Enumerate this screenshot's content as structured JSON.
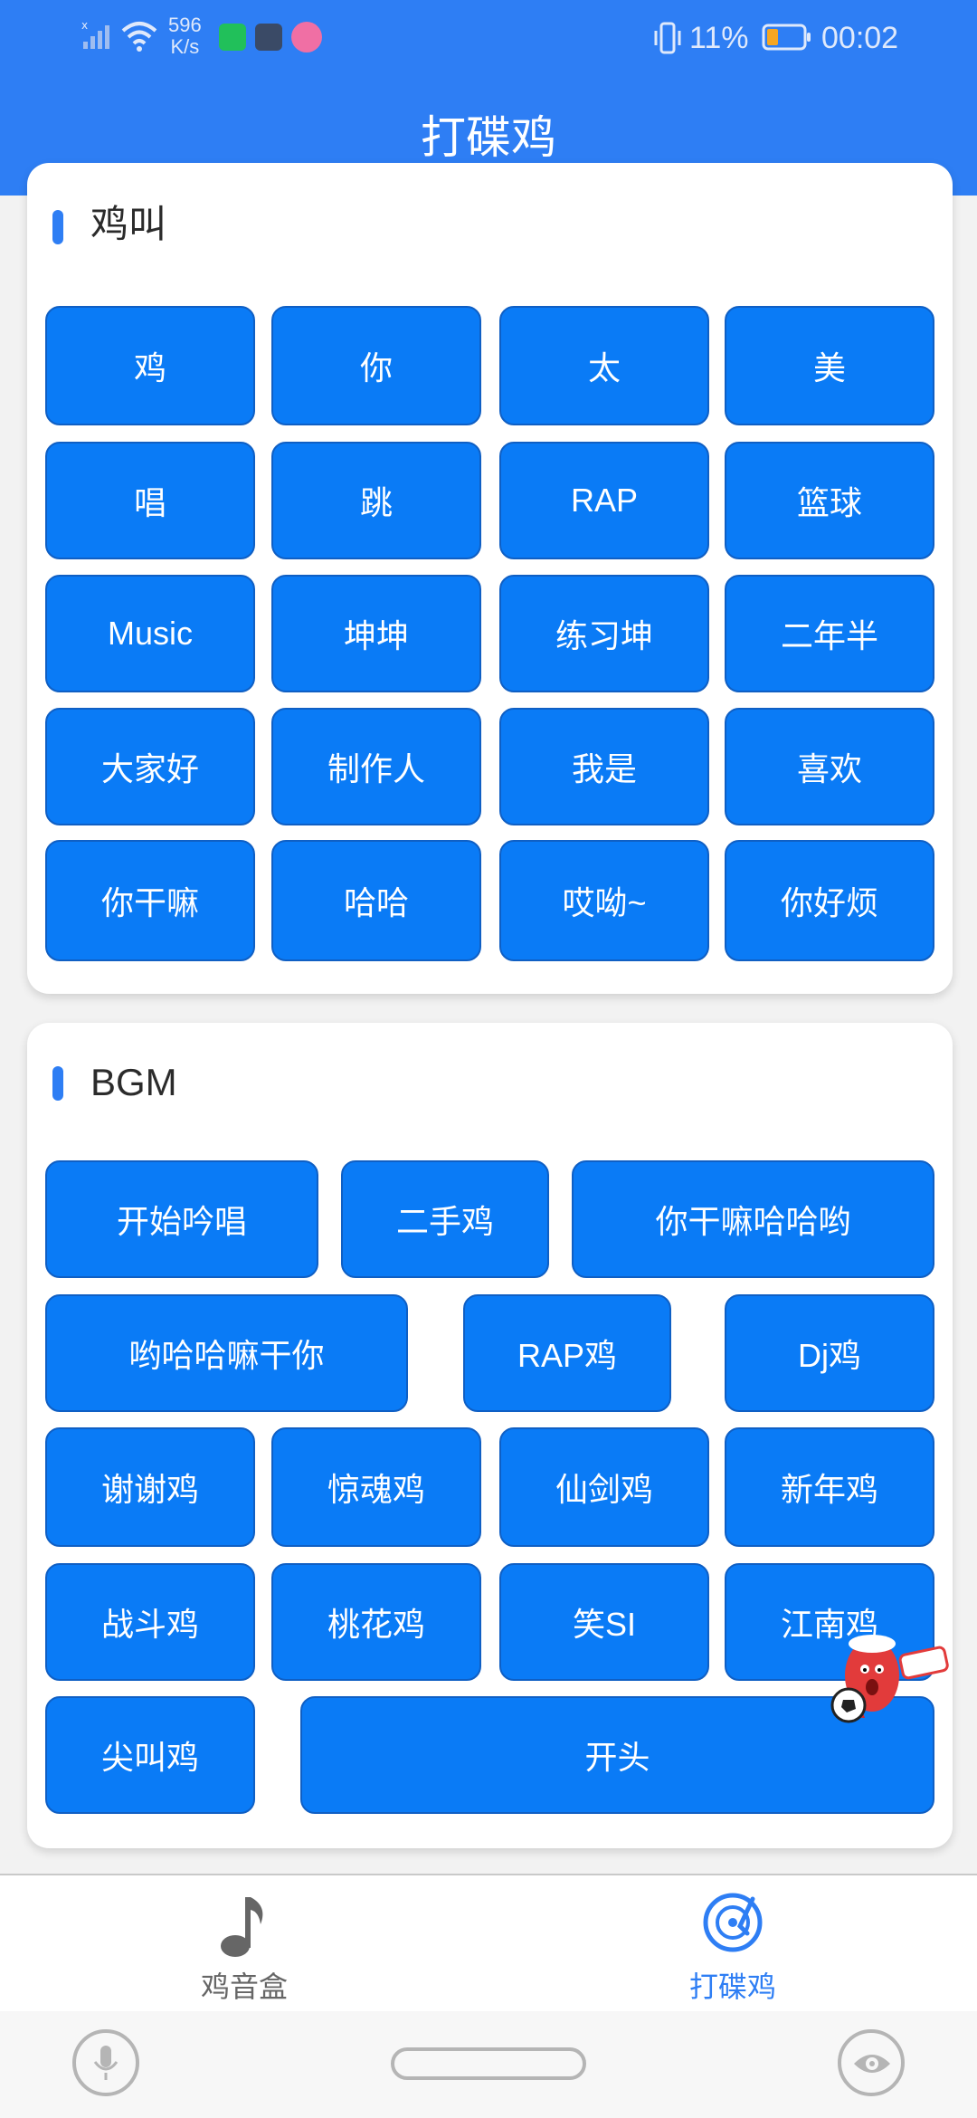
{
  "status_bar": {
    "net_speed_value": "596",
    "net_speed_unit": "K/s",
    "battery_percent": "11%",
    "time": "00:02"
  },
  "app_title": "打碟鸡",
  "sections": [
    {
      "title": "鸡叫",
      "buttons": [
        "鸡",
        "你",
        "太",
        "美",
        "唱",
        "跳",
        "RAP",
        "篮球",
        "Music",
        "坤坤",
        "练习坤",
        "二年半",
        "大家好",
        "制作人",
        "我是",
        "喜欢",
        "你干嘛",
        "哈哈",
        "哎呦~",
        "你好烦"
      ]
    },
    {
      "title": "BGM",
      "buttons": [
        "开始吟唱",
        "二手鸡",
        "你干嘛哈哈哟",
        "哟哈哈嘛干你",
        "RAP鸡",
        "Dj鸡",
        "谢谢鸡",
        "惊魂鸡",
        "仙剑鸡",
        "新年鸡",
        "战斗鸡",
        "桃花鸡",
        "笑SI",
        "江南鸡",
        "尖叫鸡",
        "开头"
      ]
    }
  ],
  "bottom_nav": {
    "tabs": [
      {
        "label": "鸡音盒",
        "icon": "music-note-icon",
        "active": false
      },
      {
        "label": "打碟鸡",
        "icon": "turntable-icon",
        "active": true
      }
    ]
  },
  "colors": {
    "accent": "#2e7ef4",
    "button": "#0a7bf6",
    "inactive_nav": "#666666"
  }
}
